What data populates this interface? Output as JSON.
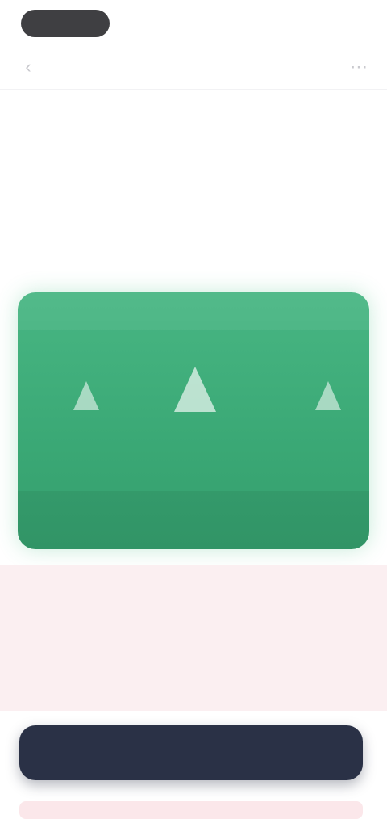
{
  "status_bar": {
    "time_pill": "",
    "right_text": ""
  },
  "header": {
    "title": "",
    "back_icon": "chevron-left-icon",
    "share_icon": "share-icon"
  },
  "card": {
    "background": "#3aa875",
    "podium": [
      {
        "position": "left",
        "name": ""
      },
      {
        "position": "center",
        "name": ""
      },
      {
        "position": "right",
        "name": ""
      }
    ]
  },
  "info": {
    "title": "",
    "body": ""
  },
  "action": {
    "button_label": ""
  },
  "colors": {
    "accent_green": "#3aa875",
    "button_dark": "#2a3146",
    "info_bg": "#fbeff1"
  }
}
